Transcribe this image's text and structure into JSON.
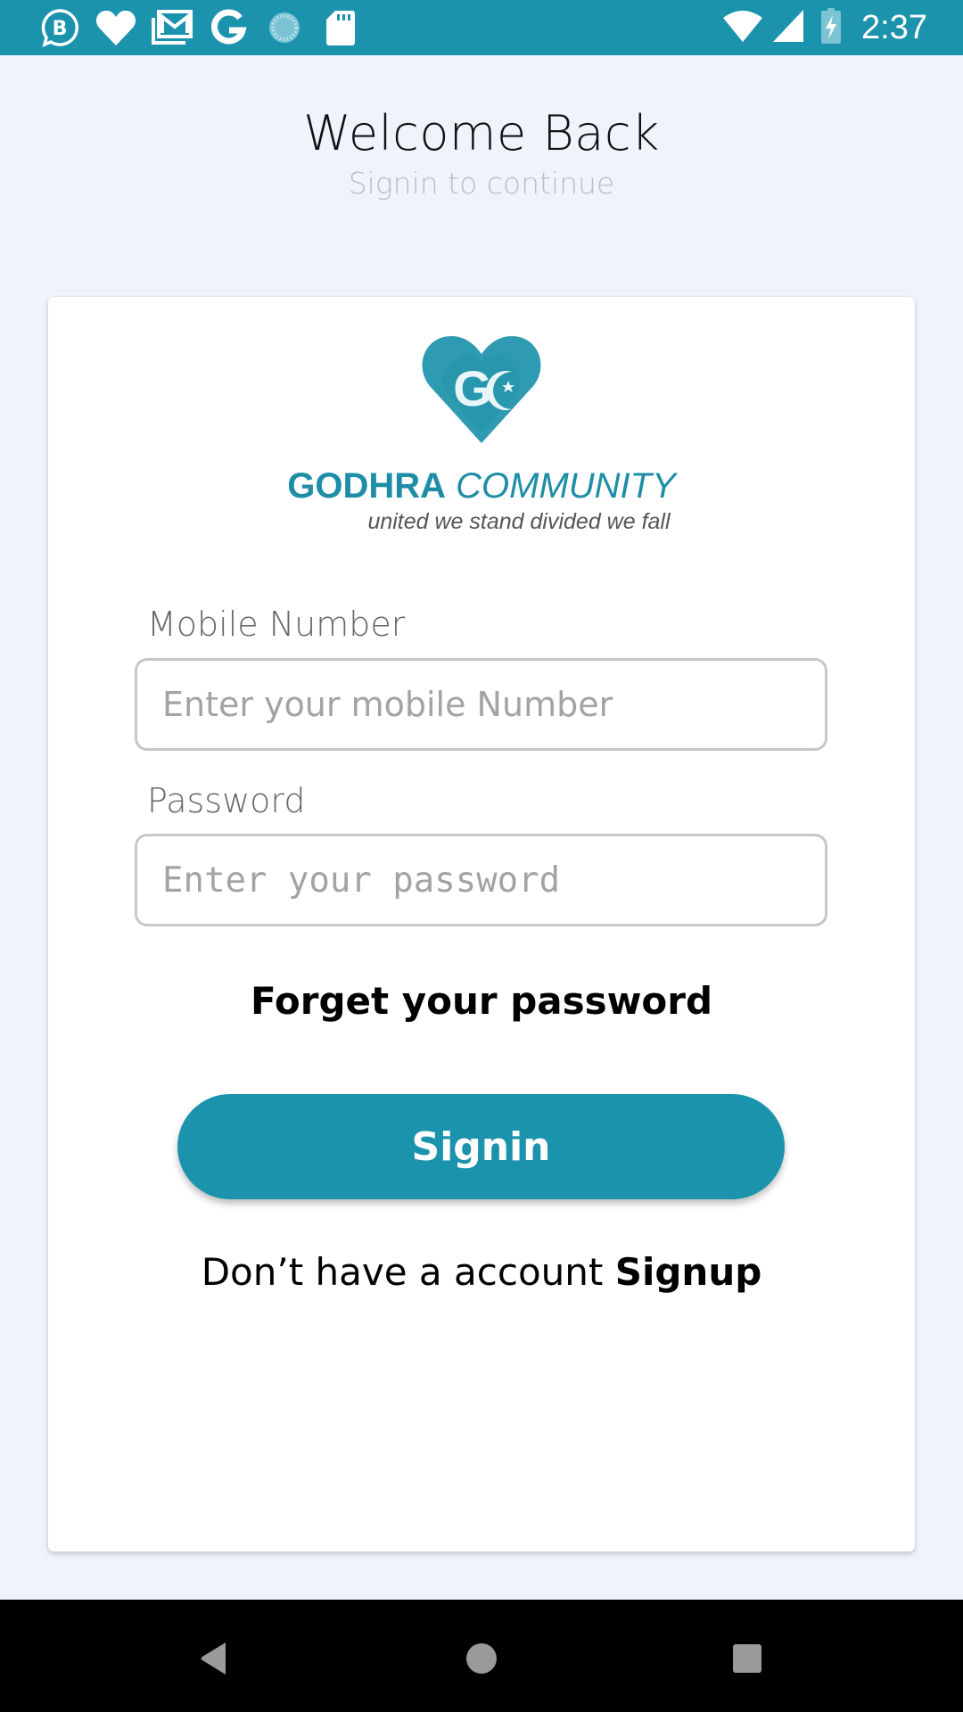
{
  "status_bar": {
    "time": "2:37",
    "left_icons": [
      "business-chat-icon",
      "heart-icon",
      "gmail-icon",
      "google-icon",
      "sync-icon",
      "sd-card-icon"
    ],
    "right_icons": [
      "wifi-icon",
      "signal-icon",
      "battery-charging-icon"
    ]
  },
  "header": {
    "title": "Welcome Back",
    "subtitle": "Signin to continue"
  },
  "logo": {
    "initials": "GC",
    "name_bold": "GODHRA",
    "name_light": "COMMUNITY",
    "tagline": "united we stand divided we fall",
    "brand_color": "#1b93ad"
  },
  "form": {
    "mobile_label": "Mobile Number",
    "mobile_value": "",
    "mobile_placeholder": "Enter your mobile Number",
    "password_label": "Password",
    "password_value": "",
    "password_placeholder": "Enter your password",
    "forgot_label": "Forget your password",
    "signin_label": "Signin",
    "signup_prompt": "Don’t have a account ",
    "signup_label": "Signup"
  },
  "nav_bar": {
    "buttons": [
      "back",
      "home",
      "recents"
    ]
  }
}
